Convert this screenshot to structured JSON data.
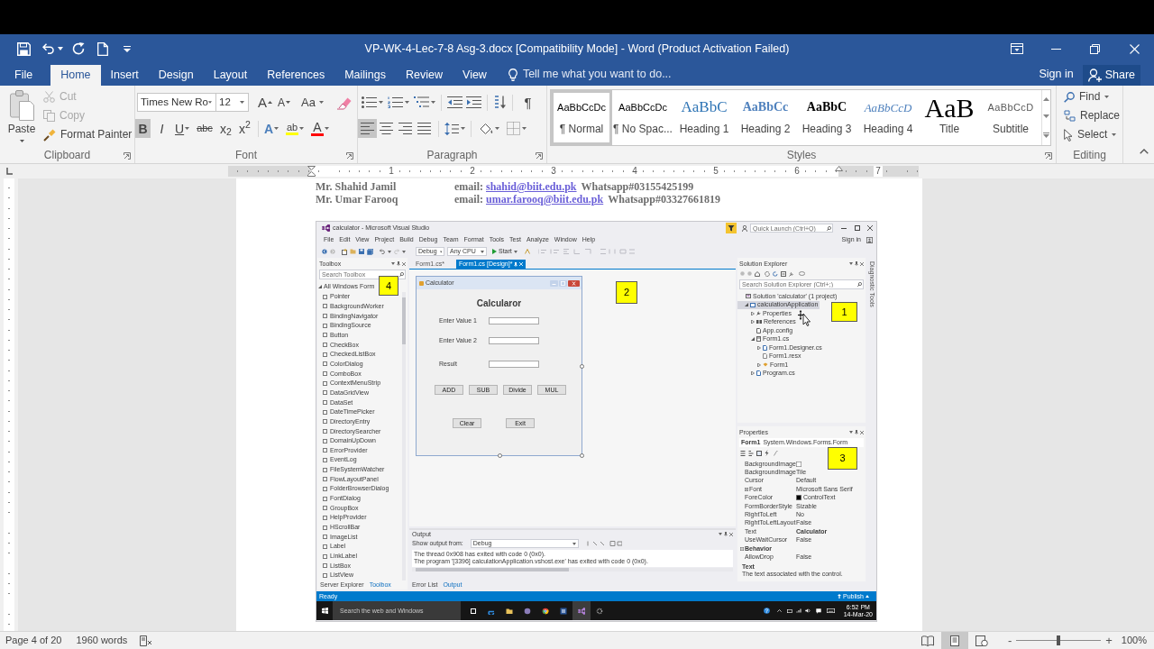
{
  "window": {
    "title": "VP-WK-4-Lec-7-8 Asg-3.docx [Compatibility Mode] - Word (Product Activation Failed)"
  },
  "tabs": [
    {
      "label": "File",
      "selected": false
    },
    {
      "label": "Home",
      "selected": true
    },
    {
      "label": "Insert",
      "selected": false
    },
    {
      "label": "Design",
      "selected": false
    },
    {
      "label": "Layout",
      "selected": false
    },
    {
      "label": "References",
      "selected": false
    },
    {
      "label": "Mailings",
      "selected": false
    },
    {
      "label": "Review",
      "selected": false
    },
    {
      "label": "View",
      "selected": false
    }
  ],
  "tell_me": {
    "placeholder": "Tell me what you want to do..."
  },
  "account": {
    "sign_in": "Sign in",
    "share": "Share"
  },
  "ribbon": {
    "clipboard": {
      "title": "Clipboard",
      "paste": "Paste",
      "cut": {
        "label": "Cut",
        "disabled": true
      },
      "copy": {
        "label": "Copy",
        "disabled": true
      },
      "format_painter": {
        "label": "Format Painter",
        "disabled": false
      }
    },
    "font": {
      "title": "Font",
      "font_name": "Times New Ro",
      "font_size": "12",
      "size_tools": [
        {
          "kind": "grow",
          "glyph": "A"
        },
        {
          "kind": "shrink",
          "glyph": "A"
        },
        {
          "kind": "case",
          "glyph": "Aa"
        }
      ],
      "format_buttons": [
        {
          "kind": "bold",
          "glyph": "B",
          "selected": true
        },
        {
          "kind": "italic",
          "glyph": "I",
          "selected": false
        },
        {
          "kind": "underline",
          "glyph": "U",
          "selected": false
        },
        {
          "kind": "strikethrough",
          "glyph": "abc",
          "selected": false
        },
        {
          "kind": "subscript",
          "glyph": "x$_{2}$",
          "selected": false
        },
        {
          "kind": "superscript",
          "glyph": "x$^{2}$",
          "selected": false
        }
      ],
      "color_tools": [
        {
          "kind": "effects",
          "glyph": "A"
        },
        {
          "kind": "highlight",
          "glyph": "ab",
          "color": "#ffff00"
        },
        {
          "kind": "font_color",
          "glyph": "A",
          "color": "#ff0000"
        }
      ]
    },
    "paragraph": {
      "title": "Paragraph",
      "pilcrow": "¶",
      "alignment": [
        {
          "kind": "left",
          "selected": true
        },
        {
          "kind": "center",
          "selected": false
        },
        {
          "kind": "right",
          "selected": false
        },
        {
          "kind": "justify",
          "selected": false
        }
      ]
    },
    "styles": {
      "title": "Styles",
      "items": [
        {
          "kind": "normal",
          "preview": "AaBbCcDc",
          "name": "¶ Normal",
          "selected": true
        },
        {
          "kind": "no_spacing",
          "preview": "AaBbCcDc",
          "name": "¶ No Spac...",
          "selected": false
        },
        {
          "kind": "heading1",
          "preview": "AaBbC",
          "name": "Heading 1",
          "selected": false
        },
        {
          "kind": "heading2",
          "preview": "AaBbCc",
          "name": "Heading 2",
          "selected": false
        },
        {
          "kind": "heading3",
          "preview": "AaBbC",
          "name": "Heading 3",
          "selected": false
        },
        {
          "kind": "heading4",
          "preview": "AaBbCcD",
          "name": "Heading 4",
          "selected": false
        },
        {
          "kind": "title",
          "preview": "AaB",
          "name": "Title",
          "selected": false
        },
        {
          "kind": "subtitle",
          "preview": "AaBbCcD",
          "name": "Subtitle",
          "selected": false
        }
      ]
    },
    "editing": {
      "title": "Editing",
      "find": "Find",
      "replace": "Replace",
      "select": "Select"
    }
  },
  "ruler": {
    "numbers": [
      "1",
      "2",
      "3",
      "4",
      "5",
      "6",
      "7"
    ]
  },
  "document": {
    "contacts": [
      {
        "name": "Mr. Shahid Jamil",
        "email_label": "email:",
        "email": "shahid@biit.edu.pk",
        "phone": "Whatsapp#03155425199"
      },
      {
        "name": "Mr. Umar Farooq",
        "email_label": "email:",
        "email": "umar.farooq@biit.edu.pk",
        "phone": "Whatsapp#03327661819"
      }
    ],
    "screenshot": {
      "title": "calculator - Microsoft Visual Studio",
      "quick_launch": {
        "placeholder": "Quick Launch (Ctrl+Q)"
      },
      "menu": [
        "File",
        "Edit",
        "View",
        "Project",
        "Build",
        "Debug",
        "Team",
        "Format",
        "Tools",
        "Test",
        "Analyze",
        "Window",
        "Help"
      ],
      "sign_in": "Sign in",
      "toolbar": {
        "configuration": "Debug",
        "platform": "Any CPU",
        "start": "Start"
      },
      "toolbox": {
        "title": "Toolbox",
        "search": {
          "placeholder": "Search Toolbox"
        },
        "group": "All Windows Form",
        "callout": "4",
        "items": [
          "Pointer",
          "BackgroundWorker",
          "BindingNavigator",
          "BindingSource",
          "Button",
          "CheckBox",
          "CheckedListBox",
          "ColorDialog",
          "ComboBox",
          "ContextMenuStrip",
          "DataGridView",
          "DataSet",
          "DateTimePicker",
          "DirectoryEntry",
          "DirectorySearcher",
          "DomainUpDown",
          "ErrorProvider",
          "EventLog",
          "FileSystemWatcher",
          "FlowLayoutPanel",
          "FolderBrowserDialog",
          "FontDialog",
          "GroupBox",
          "HelpProvider",
          "HScrollBar",
          "ImageList",
          "Label",
          "LinkLabel",
          "ListBox",
          "ListView"
        ],
        "tabs": [
          {
            "label": "Server Explorer",
            "selected": false
          },
          {
            "label": "Toolbox",
            "selected": true
          }
        ]
      },
      "editor": {
        "tabs": [
          {
            "label": "Form1.cs*",
            "selected": false
          },
          {
            "label": "Form1.cs [Design]*",
            "selected": true
          }
        ],
        "callout": "2",
        "form": {
          "title": "Calculator",
          "heading": "Calcularor",
          "fields": [
            {
              "label": "Enter Value 1"
            },
            {
              "label": "Enter Value 2"
            },
            {
              "label": "Result"
            }
          ],
          "operations": [
            "ADD",
            "SUB",
            "Divide",
            "MUL"
          ],
          "actions": [
            "Clear",
            "Exit"
          ]
        }
      },
      "output": {
        "title": "Output",
        "source_label": "Show output from:",
        "source": "Debug",
        "lines": [
          "The thread 0x908 has exited with code 0 (0x0).",
          "The program '[3396] calculationApplication.vshost.exe' has exited with code 0 (0x0)."
        ],
        "tabs": [
          {
            "label": "Error List",
            "selected": false
          },
          {
            "label": "Output",
            "selected": true
          }
        ]
      },
      "solution_explorer": {
        "title": "Solution Explorer",
        "search": {
          "placeholder": "Search Solution Explorer (Ctrl+;)"
        },
        "callout": "1",
        "tree": [
          {
            "label": "Solution 'calculator' (1 project)",
            "kind": "solution",
            "selected": false,
            "children": [
              {
                "label": "calculationApplication",
                "kind": "project",
                "expanded": true,
                "selected": true,
                "children": [
                  {
                    "label": "Properties",
                    "kind": "properties",
                    "expanded": false,
                    "selected": false
                  },
                  {
                    "label": "References",
                    "kind": "references",
                    "expanded": false,
                    "selected": false
                  },
                  {
                    "label": "App.config",
                    "kind": "config",
                    "selected": false
                  },
                  {
                    "label": "Form1.cs",
                    "kind": "form",
                    "expanded": true,
                    "selected": false,
                    "children": [
                      {
                        "label": "Form1.Designer.cs",
                        "kind": "code",
                        "expanded": false,
                        "selected": false
                      },
                      {
                        "label": "Form1.resx",
                        "kind": "resource",
                        "selected": false
                      },
                      {
                        "label": "Form1",
                        "kind": "class",
                        "expanded": false,
                        "selected": false
                      }
                    ]
                  },
                  {
                    "label": "Program.cs",
                    "kind": "code",
                    "expanded": false,
                    "selected": false
                  }
                ]
              }
            ]
          }
        ]
      },
      "properties": {
        "title": "Properties",
        "object": "Form1",
        "object_type": "System.Windows.Forms.Form",
        "callout": "3",
        "rows": [
          {
            "kind": "property",
            "name": "BackgroundImage",
            "color": "#ffffff"
          },
          {
            "kind": "property",
            "name": "BackgroundImage",
            "value": "Tile"
          },
          {
            "kind": "property",
            "name": "Cursor",
            "value": "Default"
          },
          {
            "kind": "expandable",
            "name": "Font",
            "value": "Microsoft Sans Serif"
          },
          {
            "kind": "property",
            "name": "ForeColor",
            "value": "ControlText",
            "color": "#000000"
          },
          {
            "kind": "property",
            "name": "FormBorderStyle",
            "value": "Sizable"
          },
          {
            "kind": "property",
            "name": "RightToLeft",
            "value": "No"
          },
          {
            "kind": "property",
            "name": "RightToLeftLayout",
            "value": "False"
          },
          {
            "kind": "changed",
            "name": "Text",
            "value": "Calculator"
          },
          {
            "kind": "property",
            "name": "UseWaitCursor",
            "value": "False"
          },
          {
            "kind": "category",
            "name": "Behavior"
          },
          {
            "kind": "property",
            "name": "AllowDrop",
            "value": "False"
          }
        ],
        "description": {
          "title": "Text",
          "text": "The text associated with the control."
        }
      },
      "side_strip": "Diagnostic Tools",
      "status": {
        "text": "Ready",
        "publish": "Publish"
      },
      "taskbar": {
        "search": {
          "placeholder": "Search the web and Windows"
        },
        "time": "6:52 PM",
        "date": "14-Mar-20"
      }
    }
  },
  "status_bar": {
    "page": "Page 4 of 20",
    "words": "1960 words",
    "views": [
      {
        "kind": "read",
        "selected": false
      },
      {
        "kind": "print",
        "selected": true
      },
      {
        "kind": "web",
        "selected": false
      }
    ],
    "zoom_out": "-",
    "zoom_in": "+",
    "zoom": {
      "level": 0.5
    },
    "zoom_label": "100%"
  }
}
